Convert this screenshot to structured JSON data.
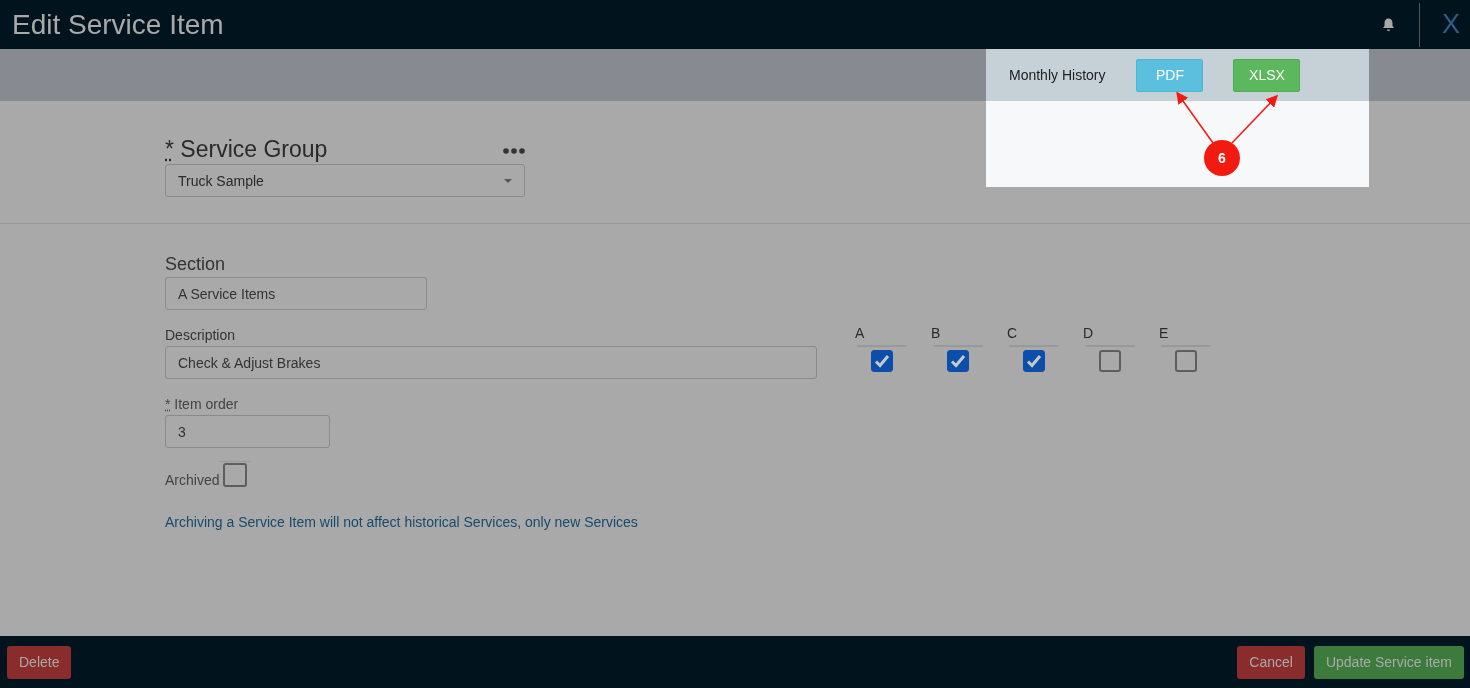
{
  "header": {
    "title": "Edit Service Item",
    "close": "X"
  },
  "toolbar": {
    "label": "Monthly History",
    "buttons": [
      "PDF",
      "XLSX"
    ]
  },
  "callout": {
    "number": "6"
  },
  "service_group": {
    "required": "*",
    "label": "Service Group",
    "value": "Truck Sample"
  },
  "section": {
    "label": "Section",
    "value": "A Service Items"
  },
  "description": {
    "label": "Description",
    "value": "Check & Adjust Brakes"
  },
  "classes": [
    {
      "label": "A",
      "checked": true
    },
    {
      "label": "B",
      "checked": true
    },
    {
      "label": "C",
      "checked": true
    },
    {
      "label": "D",
      "checked": false
    },
    {
      "label": "E",
      "checked": false
    }
  ],
  "item_order": {
    "required": "*",
    "label": "Item order",
    "value": "3"
  },
  "archived": {
    "label": "Archived",
    "checked": false
  },
  "note": "Archiving a Service Item will not affect historical Services, only new Services",
  "footer": {
    "delete": "Delete",
    "cancel": "Cancel",
    "update": "Update Service item"
  }
}
